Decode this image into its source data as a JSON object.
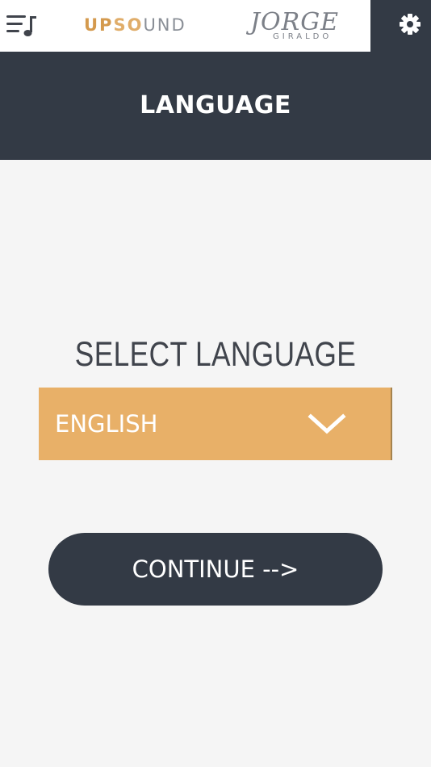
{
  "header": {
    "brand": {
      "up": "UP",
      "so": "SO",
      "und": "UND"
    },
    "signature": {
      "main": "JORGE",
      "sub": "GIRALDO"
    },
    "icons": {
      "playlist": "playlist-music-icon",
      "settings": "gear-icon"
    }
  },
  "page": {
    "title": "LANGUAGE"
  },
  "language": {
    "label": "SELECT LANGUAGE",
    "selected": "ENGLISH",
    "dropdown_icon": "chevron-down-icon"
  },
  "actions": {
    "continue_label": "CONTINUE -->"
  },
  "colors": {
    "dark": "#333a45",
    "accent": "#e8b068",
    "brand_orange": "#d49a4e",
    "background": "#f5f5f5"
  }
}
